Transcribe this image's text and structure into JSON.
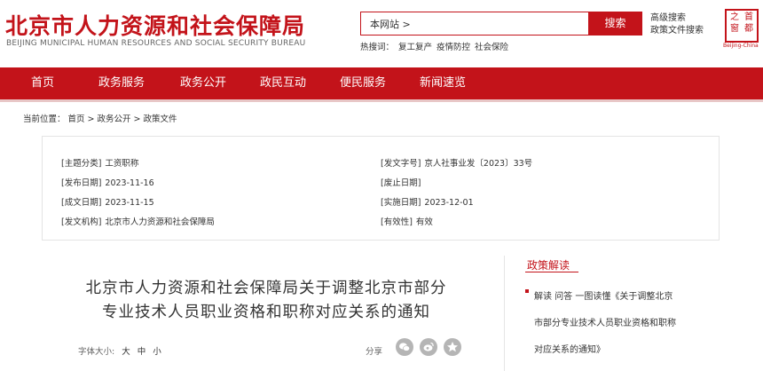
{
  "header": {
    "title": "北京市人力资源和社会保障局",
    "title_en": "BEIJING MUNICIPAL HUMAN RESOURCES AND SOCIAL SECURITY BUREAU",
    "search_value": "本网站 >",
    "search_button": "搜索",
    "advanced_search": "高级搜索",
    "policy_search": "政策文件搜索",
    "hot_label": "热搜词：",
    "hot_words": [
      "复工复产",
      "疫情防控",
      "社会保险"
    ],
    "seal_chars": [
      "首",
      "都",
      "之",
      "窗"
    ],
    "seal_caption": "Beijing-China"
  },
  "nav": {
    "items": [
      "首页",
      "政务服务",
      "政务公开",
      "政民互动",
      "便民服务",
      "新闻速览"
    ]
  },
  "breadcrumb": {
    "label": "当前位置：",
    "items": [
      "首页",
      ">",
      "政务公开",
      ">",
      "政策文件"
    ]
  },
  "meta": {
    "topic_key": "[主题分类]",
    "topic_val": "工资职称",
    "docno_key": "[发文字号]",
    "docno_val": "京人社事业发〔2023〕33号",
    "pubdate_key": "[发布日期]",
    "pubdate_val": "2023-11-16",
    "abolish_key": "[废止日期]",
    "abolish_val": "",
    "writedate_key": "[成文日期]",
    "writedate_val": "2023-11-15",
    "impl_key": "[实施日期]",
    "impl_val": "2023-12-01",
    "org_key": "[发文机构]",
    "org_val": "北京市人力资源和社会保障局",
    "valid_key": "[有效性]",
    "valid_val": "有效"
  },
  "article": {
    "title_line1": "北京市人力资源和社会保障局关于调整北京市部分",
    "title_line2": "专业技术人员职业资格和职称对应关系的通知",
    "font_size_label": "字体大小:",
    "font_sizes": [
      "大",
      "中",
      "小"
    ],
    "share_label": "分享",
    "share_icons": [
      "wechat-icon",
      "weibo-icon",
      "qzone-icon"
    ]
  },
  "sidebar": {
    "title": "政策解读",
    "item_line1": "解读 问答 一图读懂《关于调整北京",
    "item_line2": "市部分专业技术人员职业资格和职称",
    "item_line3": "对应关系的通知》"
  },
  "colors": {
    "brand_red": "#c3131a"
  }
}
